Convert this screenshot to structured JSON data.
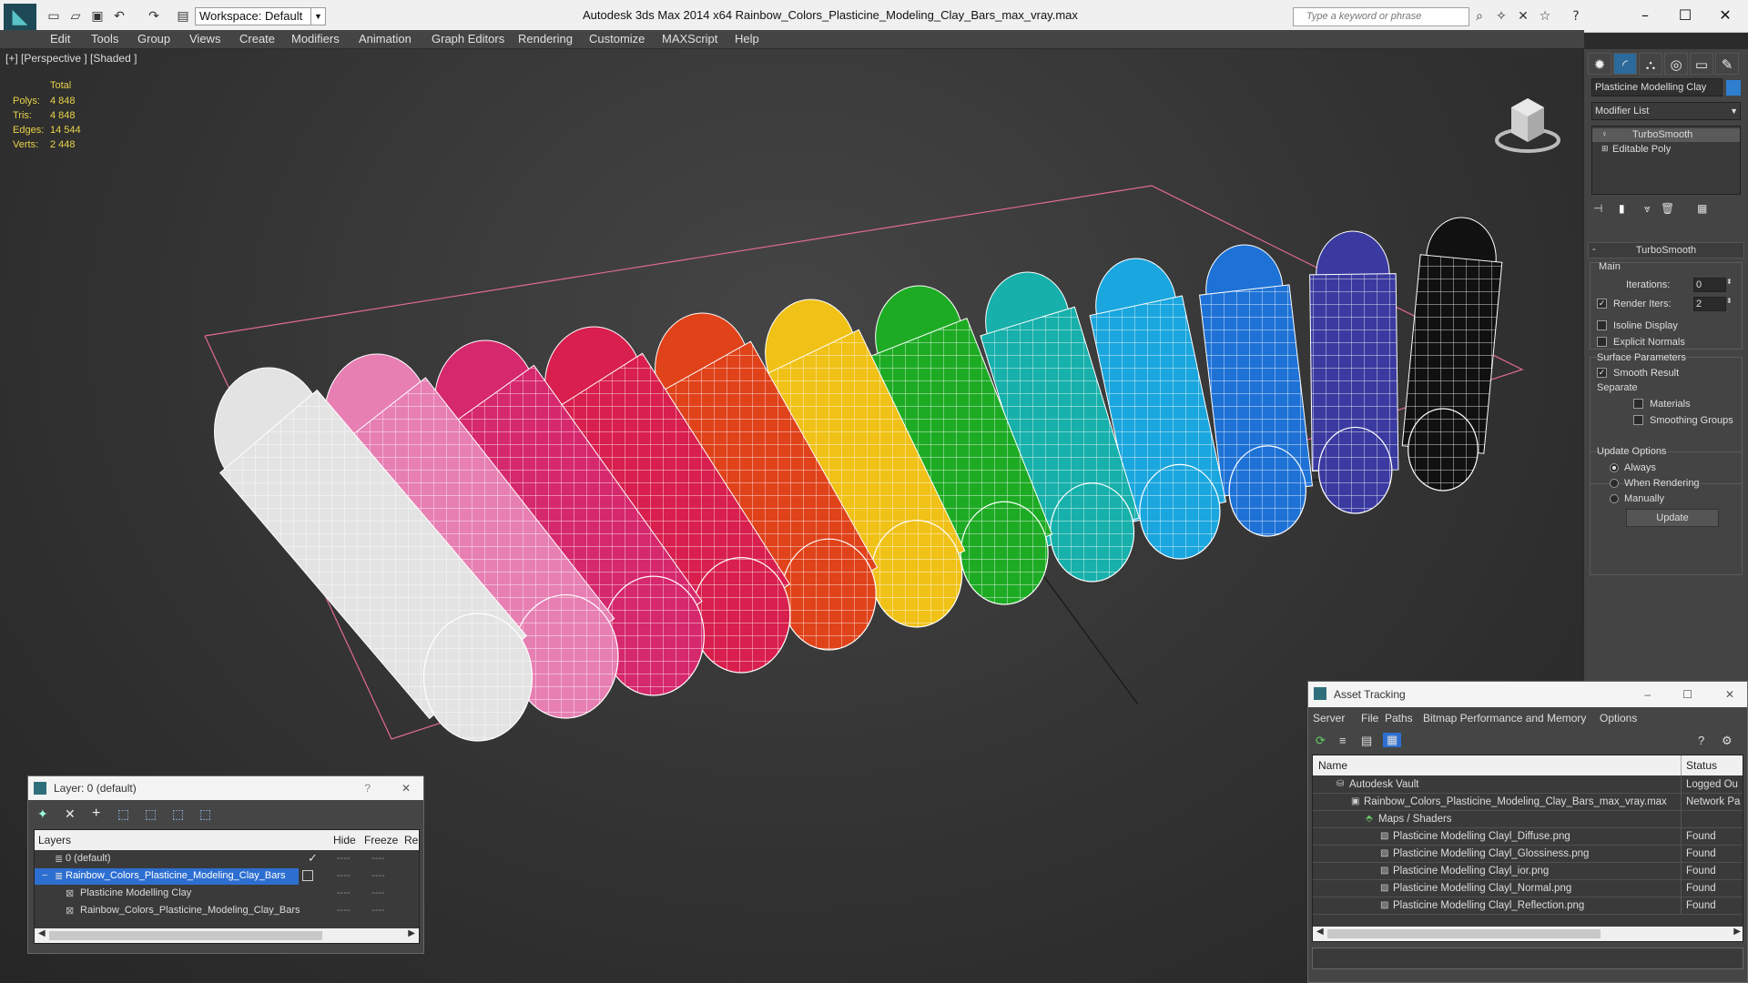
{
  "title_bar": {
    "workspace": "Workspace: Default",
    "title": "Autodesk 3ds Max  2014 x64      Rainbow_Colors_Plasticine_Modeling_Clay_Bars_max_vray.max",
    "search_placeholder": "Type a keyword or phrase"
  },
  "menu": [
    "Edit",
    "Tools",
    "Group",
    "Views",
    "Create",
    "Modifiers",
    "Animation",
    "Graph Editors",
    "Rendering",
    "Customize",
    "MAXScript",
    "Help"
  ],
  "viewport": {
    "label": "[+] [Perspective ] [Shaded ]",
    "stats_header": "Total",
    "stats": [
      {
        "label": "Polys:",
        "value": "4 848"
      },
      {
        "label": "Tris:",
        "value": "4 848"
      },
      {
        "label": "Edges:",
        "value": "14 544"
      },
      {
        "label": "Verts:",
        "value": "2 448"
      }
    ],
    "bar_colors": [
      "#e3e3e3",
      "#e77fb3",
      "#d6286c",
      "#d81f4d",
      "#e0421a",
      "#f0c116",
      "#1dab24",
      "#17b0ab",
      "#1aa6de",
      "#1e72d6",
      "#3a3aa0",
      "#111111"
    ]
  },
  "command_panel": {
    "object_name": "Plasticine Modelling Clay",
    "object_color": "#2f7fd0",
    "modifier_list": "Modifier List",
    "stack": [
      "TurboSmooth",
      "Editable Poly"
    ],
    "rollout_title": "TurboSmooth",
    "main_label": "Main",
    "iterations_label": "Iterations:",
    "iterations_value": "0",
    "render_iters_label": "Render Iters:",
    "render_iters_value": "2",
    "render_iters_checked": true,
    "isoline_label": "Isoline Display",
    "explicit_label": "Explicit Normals",
    "surface_label": "Surface Parameters",
    "smooth_label": "Smooth Result",
    "separate_label": "Separate",
    "materials_label": "Materials",
    "smoothing_groups_label": "Smoothing Groups",
    "update_options_label": "Update Options",
    "always_label": "Always",
    "when_rendering_label": "When Rendering",
    "manually_label": "Manually",
    "update_button": "Update"
  },
  "layer_window": {
    "title": "Layer: 0 (default)",
    "col_layers": "Layers",
    "col_hide": "Hide",
    "col_freeze": "Freeze",
    "col_re": "Re",
    "rows": [
      {
        "name": "0 (default)",
        "indent": 0,
        "selected": false
      },
      {
        "name": "Rainbow_Colors_Plasticine_Modeling_Clay_Bars",
        "indent": 0,
        "selected": true
      },
      {
        "name": "Plasticine Modelling Clay",
        "indent": 1,
        "selected": false
      },
      {
        "name": "Rainbow_Colors_Plasticine_Modeling_Clay_Bars",
        "indent": 1,
        "selected": false
      }
    ]
  },
  "asset_window": {
    "title": "Asset Tracking",
    "menu": [
      "Server",
      "File",
      "Paths",
      "Bitmap Performance and Memory",
      "Options"
    ],
    "col_name": "Name",
    "col_status": "Status",
    "rows": [
      {
        "name": "Autodesk Vault",
        "status": "Logged Ou",
        "indent": 1
      },
      {
        "name": "Rainbow_Colors_Plasticine_Modeling_Clay_Bars_max_vray.max",
        "status": "Network Pa",
        "indent": 2
      },
      {
        "name": "Maps / Shaders",
        "status": "",
        "indent": 3
      },
      {
        "name": "Plasticine Modelling Clayl_Diffuse.png",
        "status": "Found",
        "indent": 4
      },
      {
        "name": "Plasticine Modelling Clayl_Glossiness.png",
        "status": "Found",
        "indent": 4
      },
      {
        "name": "Plasticine Modelling Clayl_ior.png",
        "status": "Found",
        "indent": 4
      },
      {
        "name": "Plasticine Modelling Clayl_Normal.png",
        "status": "Found",
        "indent": 4
      },
      {
        "name": "Plasticine Modelling Clayl_Reflection.png",
        "status": "Found",
        "indent": 4
      }
    ]
  }
}
